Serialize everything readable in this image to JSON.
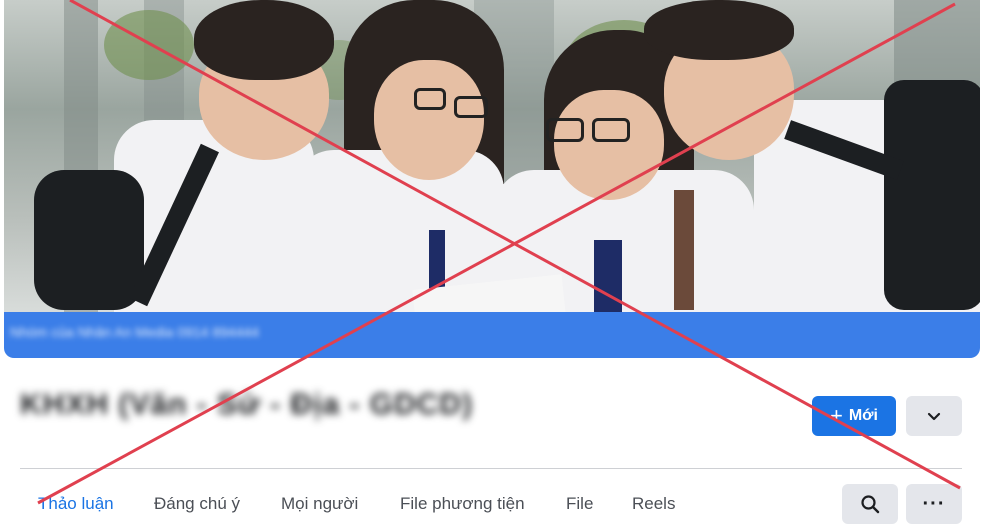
{
  "cover": {
    "group_bar_text": "Nhóm của Nhân An Media 0914 894444"
  },
  "group": {
    "name": "KHXH (Văn - Sử - Địa - GDCD)"
  },
  "actions": {
    "new_label": "Mới",
    "new_icon": "plus-icon",
    "dropdown_icon": "chevron-down-icon",
    "search_icon": "search-icon",
    "more_icon": "more-icon",
    "more_glyph": "···"
  },
  "tabs": [
    {
      "label": "Thảo luận",
      "active": true
    },
    {
      "label": "Đáng chú ý",
      "active": false
    },
    {
      "label": "Mọi người",
      "active": false
    },
    {
      "label": "File phương tiện",
      "active": false
    },
    {
      "label": "File",
      "active": false
    },
    {
      "label": "Reels",
      "active": false
    }
  ],
  "colors": {
    "accent": "#1b74e4",
    "cover_bar": "#3b7ee8",
    "cross": "#e0404f"
  }
}
